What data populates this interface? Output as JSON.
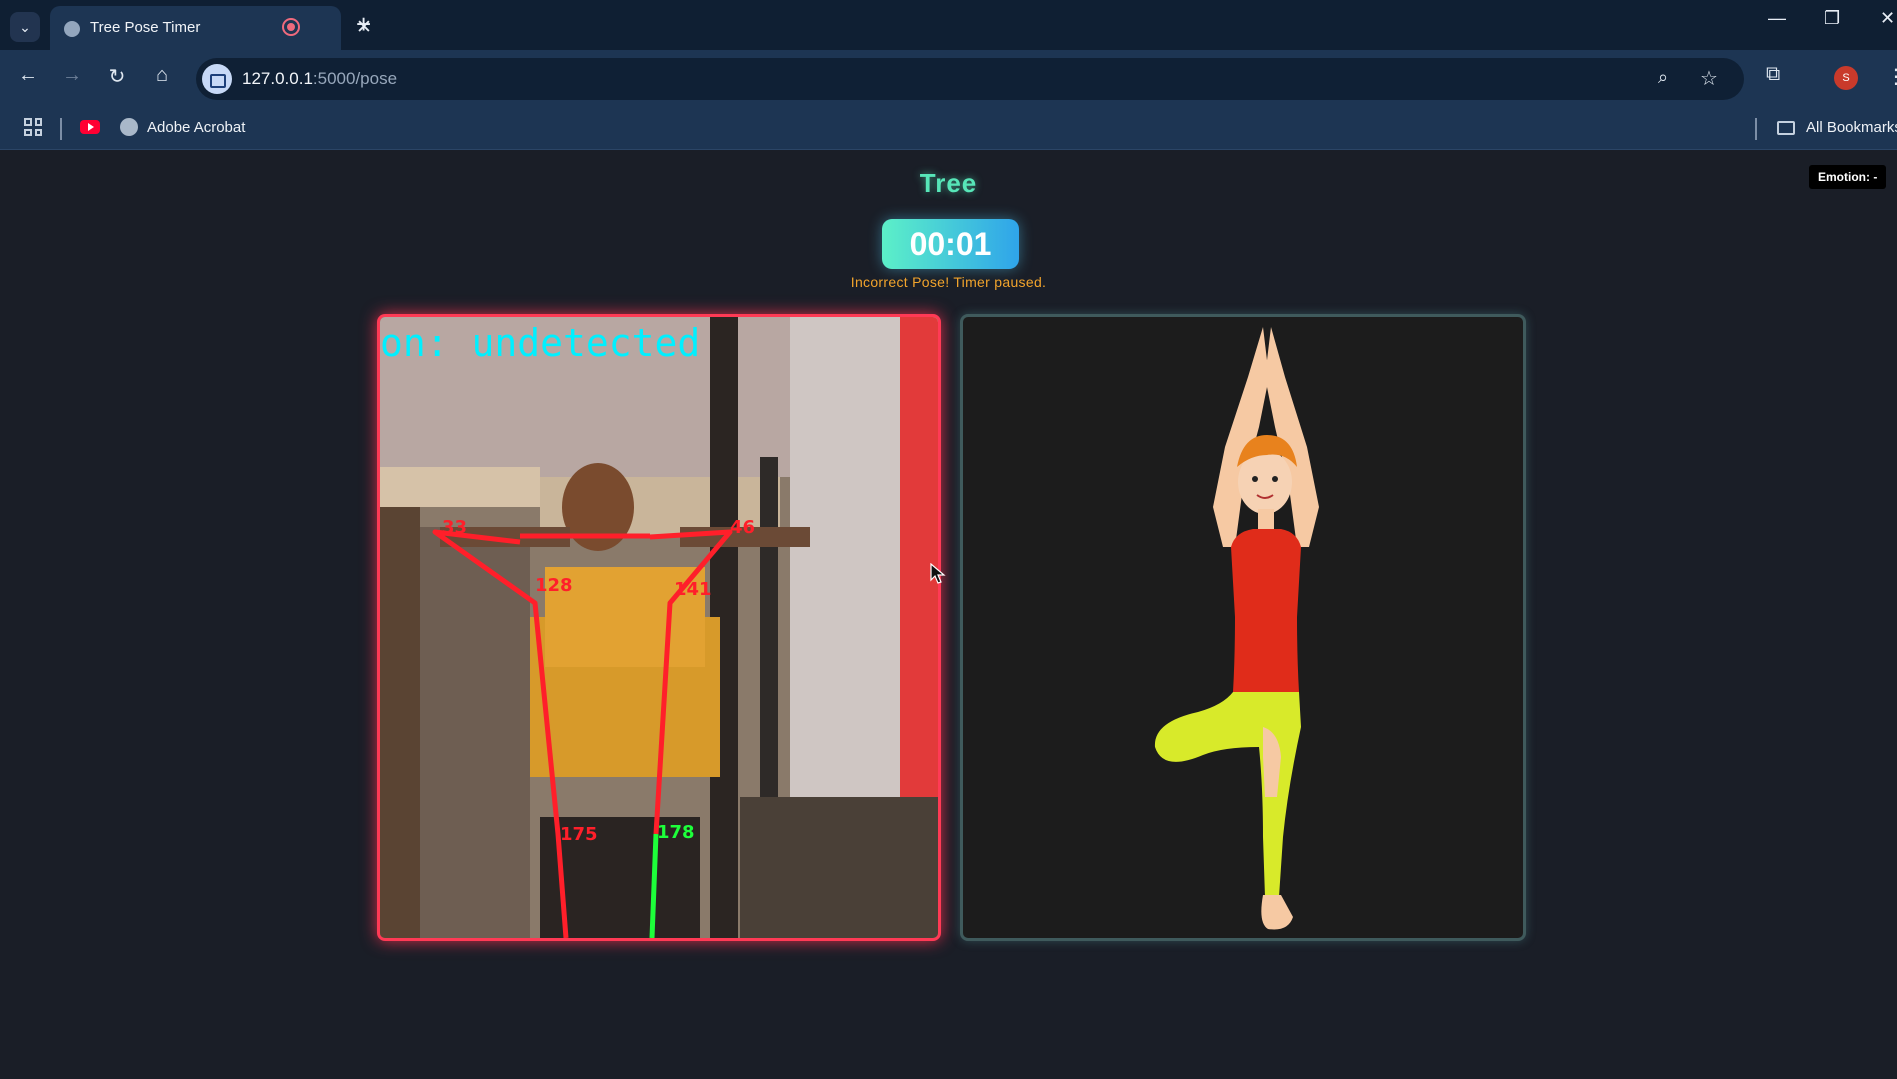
{
  "browser": {
    "tab_title": "Tree Pose Timer",
    "tab_close": "✕",
    "new_tab": "+",
    "url_host": "127.0.0.1",
    "url_path": ":5000/pose",
    "bookmark_label": "Adobe Acrobat",
    "all_bookmarks": "All Bookmarks",
    "avatar_letter": "S",
    "window_min": "—",
    "window_restore": "❐",
    "window_close": "✕"
  },
  "page": {
    "pose_name": "Tree",
    "timer": "00:01",
    "status": "Incorrect Pose! Timer paused.",
    "emotion": "Emotion: -"
  },
  "camera": {
    "overlay_text": "on: undetected",
    "angles": [
      "33",
      "46",
      "128",
      "141",
      "175",
      "178"
    ]
  },
  "colors": {
    "accent_green": "#57e6b8",
    "warning": "#f2a42c",
    "camera_border": "#ff3a55",
    "skeleton_bad": "#ff1f2a",
    "skeleton_good": "#1dff3a"
  }
}
